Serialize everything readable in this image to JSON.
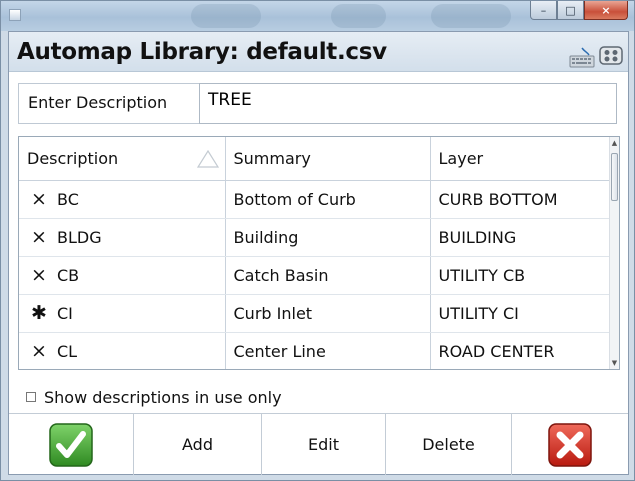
{
  "window": {
    "title": "Automap Library: default.csv",
    "caption": {
      "minimize": "–",
      "maximize": "□",
      "close": "×"
    }
  },
  "header_icons": [
    "keyboard-icon",
    "gamepad-icon"
  ],
  "description_filter": {
    "label": "Enter Description",
    "value": "TREE"
  },
  "table": {
    "columns": [
      "Description",
      "Summary",
      "Layer"
    ],
    "rows": [
      {
        "mark": "×",
        "description": "BC",
        "summary": "Bottom of Curb",
        "layer": "CURB BOTTOM"
      },
      {
        "mark": "×",
        "description": "BLDG",
        "summary": "Building",
        "layer": "BUILDING"
      },
      {
        "mark": "×",
        "description": "CB",
        "summary": "Catch Basin",
        "layer": "UTILITY CB"
      },
      {
        "mark": "✱",
        "description": "CI",
        "summary": "Curb Inlet",
        "layer": "UTILITY CI"
      },
      {
        "mark": "×",
        "description": "CL",
        "summary": "Center Line",
        "layer": "ROAD CENTER"
      }
    ]
  },
  "show_in_use": {
    "label": "Show descriptions in use only",
    "checked": false
  },
  "toolbar": {
    "add_label": "Add",
    "edit_label": "Edit",
    "delete_label": "Delete"
  },
  "colors": {
    "ok_green": "#3a9b2a",
    "cancel_red": "#d42a1e",
    "header_bg": "#dde6ef"
  }
}
